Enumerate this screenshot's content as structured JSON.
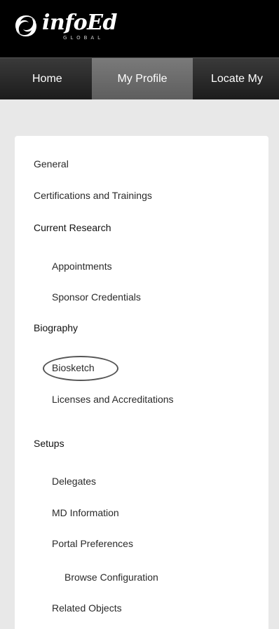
{
  "logo": {
    "word": "infoEd",
    "sub": "GLOBAL"
  },
  "nav": {
    "items": [
      {
        "label": "Home"
      },
      {
        "label": "My Profile"
      },
      {
        "label": "Locate My"
      }
    ],
    "active": "My Profile"
  },
  "menu": {
    "items": [
      {
        "label": "General"
      },
      {
        "label": "Certifications and Trainings"
      },
      {
        "label": "Current Research"
      },
      {
        "label": "Appointments"
      },
      {
        "label": "Sponsor Credentials"
      },
      {
        "label": "Biography"
      },
      {
        "label": "Biosketch"
      },
      {
        "label": "Licenses and Accreditations"
      },
      {
        "label": "Setups"
      },
      {
        "label": "Delegates"
      },
      {
        "label": "MD Information"
      },
      {
        "label": "Portal Preferences"
      },
      {
        "label": "Browse Configuration"
      },
      {
        "label": "Related Objects"
      }
    ],
    "highlighted": "Biosketch"
  },
  "colors": {
    "header_bg": "#000000",
    "nav_bg": "#2a2a2a",
    "nav_active_bg": "#6c6c6c",
    "page_bg": "#e8e8e8",
    "panel_bg": "#ffffff"
  }
}
